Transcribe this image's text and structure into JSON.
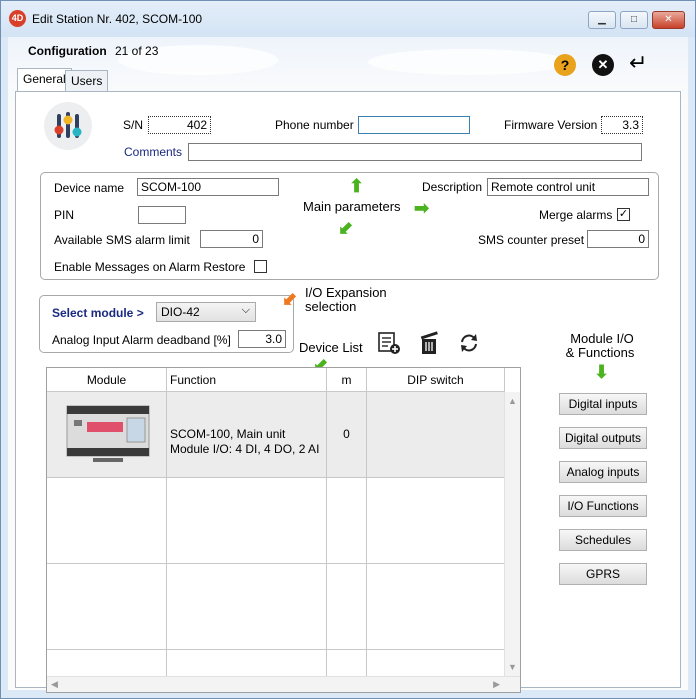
{
  "window": {
    "title": "Edit Station Nr. 402, SCOM-100",
    "logo_text": "4D",
    "minimize_glyph": "▁",
    "maximize_glyph": "□",
    "close_glyph": "✕"
  },
  "header": {
    "config_label": "Configuration",
    "config_count": "21 of 23",
    "help_glyph": "?",
    "close_glyph": "✕",
    "enter_glyph": "↵"
  },
  "tabs": [
    {
      "label": "General",
      "active": true
    },
    {
      "label": "Users",
      "active": false
    }
  ],
  "identity": {
    "sn_label": "S/N",
    "sn_value": "402",
    "phone_label": "Phone number",
    "phone_value": "",
    "firmware_label": "Firmware Version",
    "firmware_value": "3.3",
    "comments_label": "Comments",
    "comments_value": ""
  },
  "main_params": {
    "device_name_label": "Device name",
    "device_name_value": "SCOM-100",
    "pin_label": "PIN",
    "pin_value": "",
    "sms_limit_label": "Available SMS alarm limit",
    "sms_limit_value": "0",
    "enable_restore_label": "Enable Messages on Alarm Restore",
    "enable_restore_checked": false,
    "description_label": "Description",
    "description_value": "Remote control unit",
    "merge_alarms_label": "Merge alarms",
    "merge_alarms_checked": true,
    "sms_preset_label": "SMS counter preset",
    "sms_preset_value": "0",
    "annotation": "Main parameters"
  },
  "module": {
    "select_label": "Select module >",
    "selected": "DIO-42",
    "deadband_label": "Analog Input Alarm deadband [%]",
    "deadband_value": "3.0",
    "annotation_line1": "I/O Expansion",
    "annotation_line2": "selection"
  },
  "device_list": {
    "annotation": "Device List",
    "columns": [
      "Module",
      "Function",
      "m",
      "DIP switch"
    ],
    "rows": [
      {
        "function_line1": "SCOM-100, Main unit",
        "function_line2": "Module I/O: 4 DI, 4 DO, 2 AI",
        "m": "0",
        "dip": ""
      }
    ]
  },
  "side_panel": {
    "annotation_line1": "Module I/O",
    "annotation_line2": "& Functions",
    "buttons": [
      "Digital inputs",
      "Digital outputs",
      "Analog inputs",
      "I/O Functions",
      "Schedules",
      "GPRS"
    ]
  },
  "colors": {
    "accent_green": "#4bb320",
    "accent_orange": "#f07820",
    "help_yellow": "#e8a21c",
    "label_blue": "#1a2a80"
  }
}
